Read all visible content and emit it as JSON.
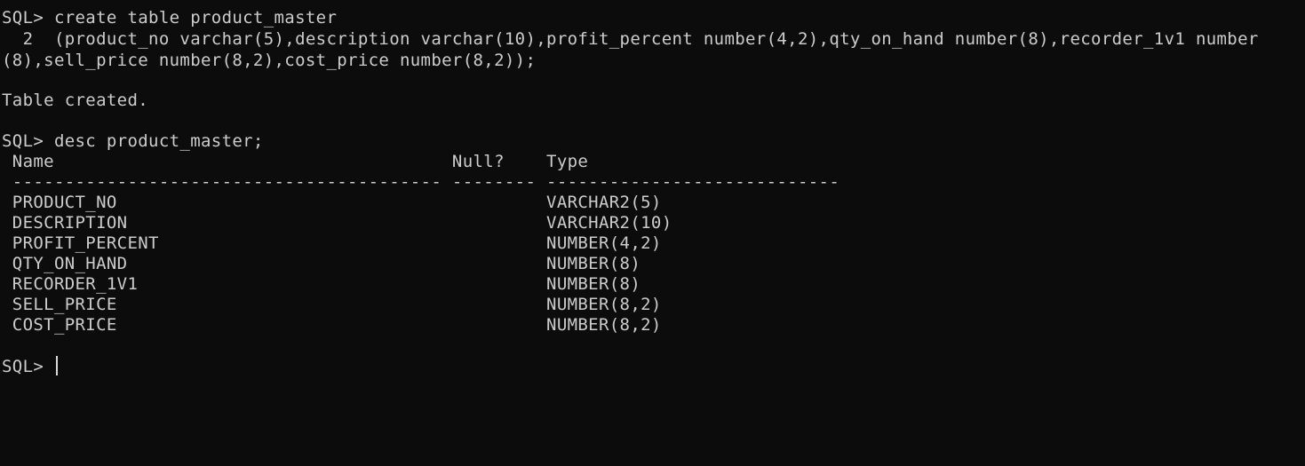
{
  "terminal": {
    "lines": [
      "SQL> create table product_master",
      "  2  (product_no varchar(5),description varchar(10),profit_percent number(4,2),qty_on_hand number(8),recorder_1v1 number",
      "(8),sell_price number(8,2),cost_price number(8,2));",
      "",
      "Table created.",
      "",
      "SQL> desc product_master;",
      " Name                                      Null?    Type",
      " ----------------------------------------- -------- ----------------------------",
      " PRODUCT_NO                                         VARCHAR2(5)",
      " DESCRIPTION                                        VARCHAR2(10)",
      " PROFIT_PERCENT                                     NUMBER(4,2)",
      " QTY_ON_HAND                                        NUMBER(8)",
      " RECORDER_1V1                                       NUMBER(8)",
      " SELL_PRICE                                         NUMBER(8,2)",
      " COST_PRICE                                         NUMBER(8,2)",
      "",
      "SQL> "
    ]
  },
  "colors": {
    "background": "#0c0c0c",
    "foreground": "#cccccc"
  }
}
